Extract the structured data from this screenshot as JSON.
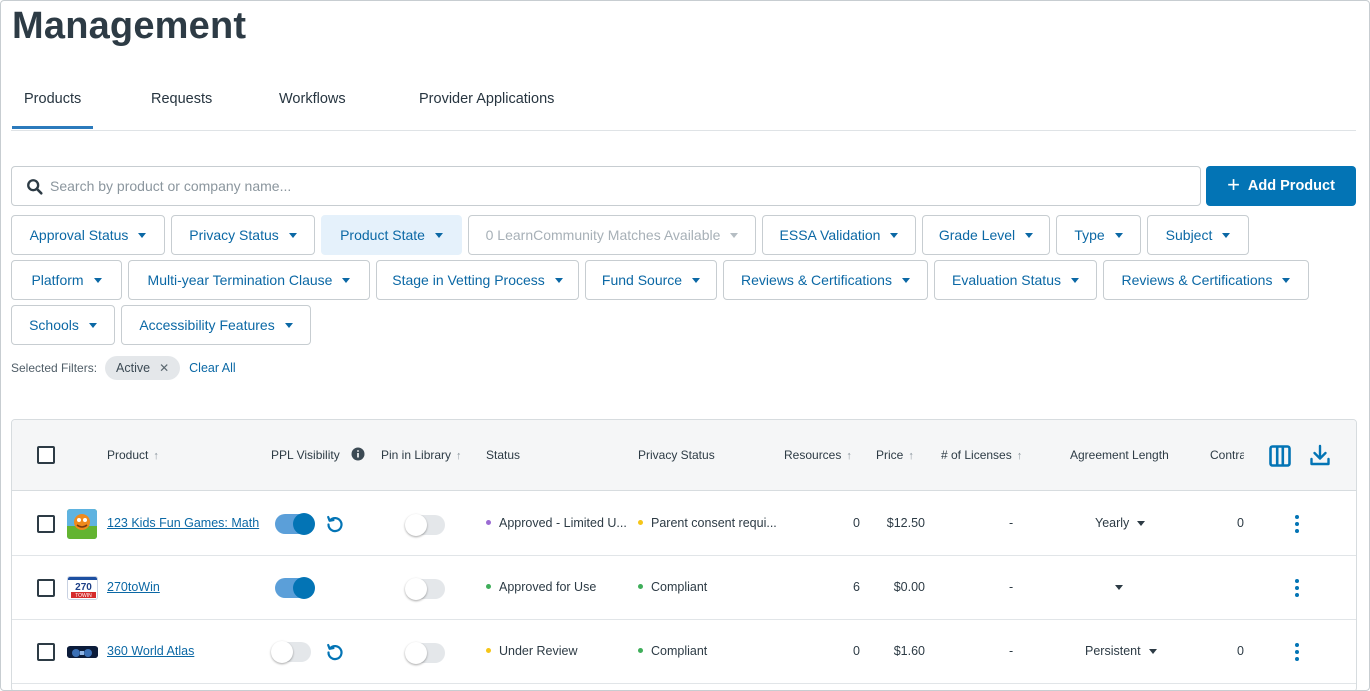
{
  "page": {
    "title": "Management"
  },
  "tabs": [
    {
      "label": "Products",
      "active": true
    },
    {
      "label": "Requests",
      "active": false
    },
    {
      "label": "Workflows",
      "active": false
    },
    {
      "label": "Provider Applications",
      "active": false
    }
  ],
  "search": {
    "placeholder": "Search by product or company name...",
    "value": "",
    "icon": "search-icon"
  },
  "toolbar": {
    "add_label": "Add Product",
    "add_icon": "plus-icon"
  },
  "filters": {
    "row1": [
      "Approval Status",
      "Privacy Status",
      "Product State",
      "0 LearnCommunity Matches Available",
      "ESSA Validation",
      "Grade Level",
      "Type",
      "Subject"
    ],
    "row2": [
      "Platform",
      "Multi-year Termination Clause",
      "Stage in Vetting Process",
      "Fund Source",
      "Reviews & Certifications",
      "Evaluation Status",
      "Reviews & Certifications"
    ],
    "row3": [
      "Schools",
      "Accessibility Features"
    ]
  },
  "selected_filters": {
    "label": "Selected Filters:",
    "chips": [
      "Active"
    ],
    "clear_label": "Clear All"
  },
  "table": {
    "headers": {
      "product": "Product",
      "ppl_visibility": "PPL Visibility",
      "pin_in_library": "Pin in Library",
      "status": "Status",
      "privacy_status": "Privacy Status",
      "resources": "Resources",
      "price": "Price",
      "licenses": "# of Licenses",
      "agreement_length": "Agreement Length",
      "contract": "Contra"
    },
    "rows": [
      {
        "product": "123 Kids Fun Games: Math",
        "ppl_visible": true,
        "pinned": false,
        "status": "Approved - Limited U...",
        "status_color": "#9b6bd3",
        "privacy": "Parent consent requi...",
        "privacy_color": "#f5c518",
        "resources": "0",
        "price": "$12.50",
        "licenses": "-",
        "agreement": "Yearly",
        "contract": "0"
      },
      {
        "product": "270toWin",
        "ppl_visible": true,
        "pinned": false,
        "status": "Approved for Use",
        "status_color": "#3fae5a",
        "privacy": "Compliant",
        "privacy_color": "#3fae5a",
        "resources": "6",
        "price": "$0.00",
        "licenses": "-",
        "agreement": "",
        "contract": ""
      },
      {
        "product": "360 World Atlas",
        "ppl_visible": false,
        "pinned": false,
        "status": "Under Review",
        "status_color": "#f5c518",
        "privacy": "Compliant",
        "privacy_color": "#3fae5a",
        "resources": "0",
        "price": "$1.60",
        "licenses": "-",
        "agreement": "Persistent",
        "contract": "0"
      }
    ]
  },
  "colors": {
    "accent": "#0374b5",
    "link": "#0b68a5"
  }
}
